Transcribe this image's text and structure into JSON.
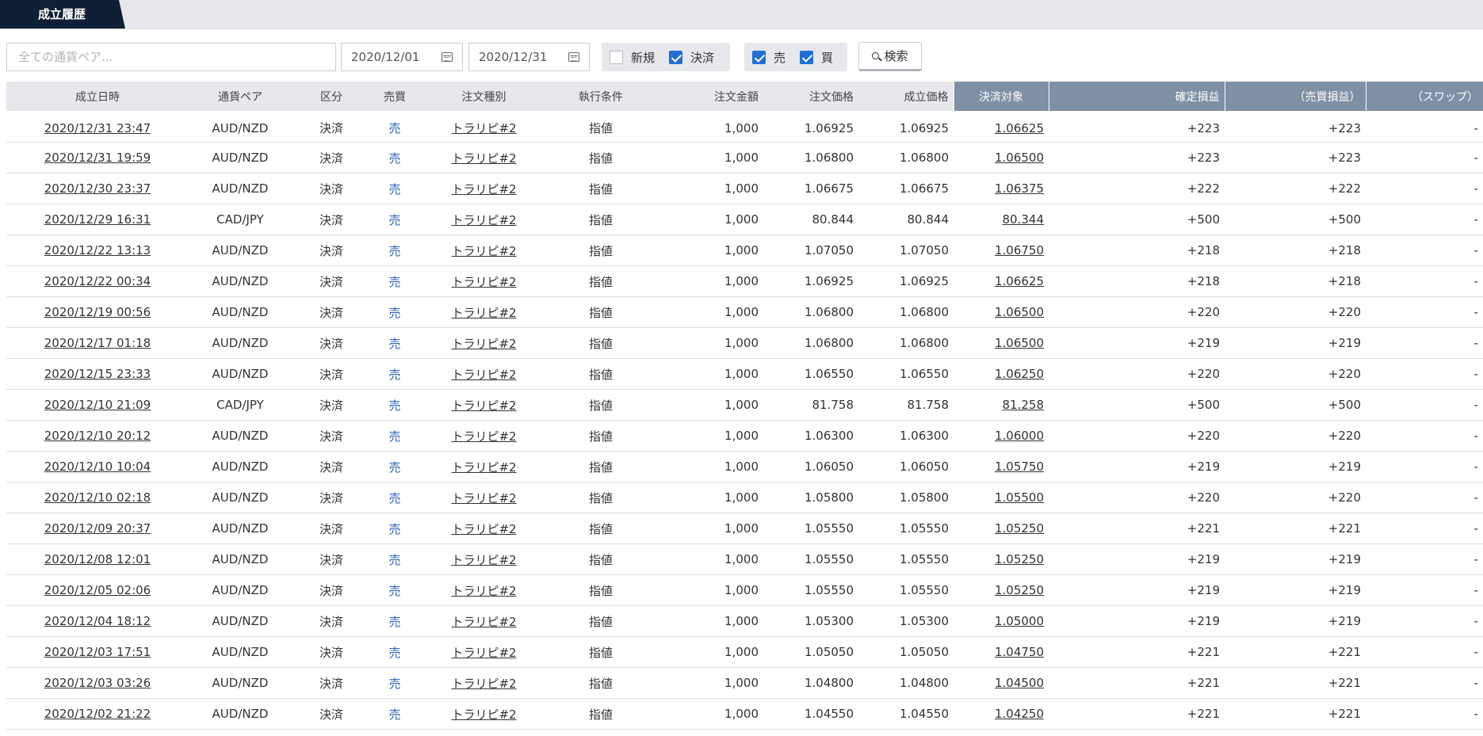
{
  "tab": {
    "label": "成立履歴"
  },
  "filters": {
    "pair_placeholder": "全ての通貨ペア...",
    "date_from": "2020/12/01",
    "date_to": "2020/12/31",
    "kind": [
      {
        "label": "新規",
        "checked": false
      },
      {
        "label": "決済",
        "checked": true
      }
    ],
    "side": [
      {
        "label": "売",
        "checked": true
      },
      {
        "label": "買",
        "checked": true
      }
    ],
    "search_label": "検索"
  },
  "table": {
    "headers": [
      "成立日時",
      "通貨ペア",
      "区分",
      "売買",
      "注文種別",
      "執行条件",
      "注文金額",
      "注文価格",
      "成立価格",
      "決済対象",
      "確定損益",
      "（売買損益）",
      "（スワップ）"
    ],
    "rows": [
      [
        "2020/12/31 23:47",
        "AUD/NZD",
        "決済",
        "売",
        "トラリピ#2",
        "指値",
        "1,000",
        "1.06925",
        "1.06925",
        "1.06625",
        "+223",
        "+223",
        "-"
      ],
      [
        "2020/12/31 19:59",
        "AUD/NZD",
        "決済",
        "売",
        "トラリピ#2",
        "指値",
        "1,000",
        "1.06800",
        "1.06800",
        "1.06500",
        "+223",
        "+223",
        "-"
      ],
      [
        "2020/12/30 23:37",
        "AUD/NZD",
        "決済",
        "売",
        "トラリピ#2",
        "指値",
        "1,000",
        "1.06675",
        "1.06675",
        "1.06375",
        "+222",
        "+222",
        "-"
      ],
      [
        "2020/12/29 16:31",
        "CAD/JPY",
        "決済",
        "売",
        "トラリピ#2",
        "指値",
        "1,000",
        "80.844",
        "80.844",
        "80.344",
        "+500",
        "+500",
        "-"
      ],
      [
        "2020/12/22 13:13",
        "AUD/NZD",
        "決済",
        "売",
        "トラリピ#2",
        "指値",
        "1,000",
        "1.07050",
        "1.07050",
        "1.06750",
        "+218",
        "+218",
        "-"
      ],
      [
        "2020/12/22 00:34",
        "AUD/NZD",
        "決済",
        "売",
        "トラリピ#2",
        "指値",
        "1,000",
        "1.06925",
        "1.06925",
        "1.06625",
        "+218",
        "+218",
        "-"
      ],
      [
        "2020/12/19 00:56",
        "AUD/NZD",
        "決済",
        "売",
        "トラリピ#2",
        "指値",
        "1,000",
        "1.06800",
        "1.06800",
        "1.06500",
        "+220",
        "+220",
        "-"
      ],
      [
        "2020/12/17 01:18",
        "AUD/NZD",
        "決済",
        "売",
        "トラリピ#2",
        "指値",
        "1,000",
        "1.06800",
        "1.06800",
        "1.06500",
        "+219",
        "+219",
        "-"
      ],
      [
        "2020/12/15 23:33",
        "AUD/NZD",
        "決済",
        "売",
        "トラリピ#2",
        "指値",
        "1,000",
        "1.06550",
        "1.06550",
        "1.06250",
        "+220",
        "+220",
        "-"
      ],
      [
        "2020/12/10 21:09",
        "CAD/JPY",
        "決済",
        "売",
        "トラリピ#2",
        "指値",
        "1,000",
        "81.758",
        "81.758",
        "81.258",
        "+500",
        "+500",
        "-"
      ],
      [
        "2020/12/10 20:12",
        "AUD/NZD",
        "決済",
        "売",
        "トラリピ#2",
        "指値",
        "1,000",
        "1.06300",
        "1.06300",
        "1.06000",
        "+220",
        "+220",
        "-"
      ],
      [
        "2020/12/10 10:04",
        "AUD/NZD",
        "決済",
        "売",
        "トラリピ#2",
        "指値",
        "1,000",
        "1.06050",
        "1.06050",
        "1.05750",
        "+219",
        "+219",
        "-"
      ],
      [
        "2020/12/10 02:18",
        "AUD/NZD",
        "決済",
        "売",
        "トラリピ#2",
        "指値",
        "1,000",
        "1.05800",
        "1.05800",
        "1.05500",
        "+220",
        "+220",
        "-"
      ],
      [
        "2020/12/09 20:37",
        "AUD/NZD",
        "決済",
        "売",
        "トラリピ#2",
        "指値",
        "1,000",
        "1.05550",
        "1.05550",
        "1.05250",
        "+221",
        "+221",
        "-"
      ],
      [
        "2020/12/08 12:01",
        "AUD/NZD",
        "決済",
        "売",
        "トラリピ#2",
        "指値",
        "1,000",
        "1.05550",
        "1.05550",
        "1.05250",
        "+219",
        "+219",
        "-"
      ],
      [
        "2020/12/05 02:06",
        "AUD/NZD",
        "決済",
        "売",
        "トラリピ#2",
        "指値",
        "1,000",
        "1.05550",
        "1.05550",
        "1.05250",
        "+219",
        "+219",
        "-"
      ],
      [
        "2020/12/04 18:12",
        "AUD/NZD",
        "決済",
        "売",
        "トラリピ#2",
        "指値",
        "1,000",
        "1.05300",
        "1.05300",
        "1.05000",
        "+219",
        "+219",
        "-"
      ],
      [
        "2020/12/03 17:51",
        "AUD/NZD",
        "決済",
        "売",
        "トラリピ#2",
        "指値",
        "1,000",
        "1.05050",
        "1.05050",
        "1.04750",
        "+221",
        "+221",
        "-"
      ],
      [
        "2020/12/03 03:26",
        "AUD/NZD",
        "決済",
        "売",
        "トラリピ#2",
        "指値",
        "1,000",
        "1.04800",
        "1.04800",
        "1.04500",
        "+221",
        "+221",
        "-"
      ],
      [
        "2020/12/02 21:22",
        "AUD/NZD",
        "決済",
        "売",
        "トラリピ#2",
        "指値",
        "1,000",
        "1.04550",
        "1.04550",
        "1.04250",
        "+221",
        "+221",
        "-"
      ]
    ]
  },
  "colors": {
    "tab_bg": "#0f1f35",
    "header_blue": "#7f8fa6",
    "check_blue": "#1f6fd6",
    "sell_text": "#2a63b8"
  }
}
